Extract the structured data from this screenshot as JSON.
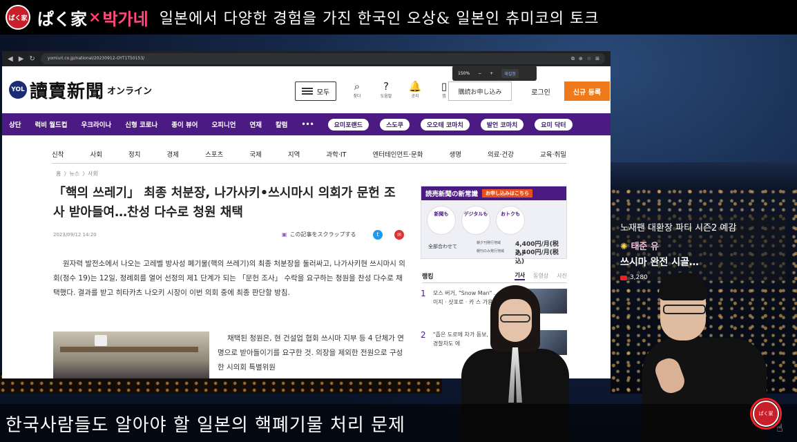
{
  "title_bar": {
    "logo_text": "ぱく家",
    "brand_jp": "ぱく家",
    "brand_x": "×",
    "brand_kr": "박가네",
    "description": "일본에서 다양한 경험을 가진 한국인 오상& 일본인 츄미코의 토크"
  },
  "browser": {
    "url": "yomiuri.co.jp/national/20230912-OYT1T50153/",
    "zoom_level": "150%",
    "zoom_minus": "−",
    "zoom_plus": "+",
    "zoom_reset": "재설정"
  },
  "site_header": {
    "badge": "YOL",
    "logo": "讀賣新聞",
    "logo_sub": "オンライン",
    "menu_label": "모두",
    "icons": [
      {
        "glyph": "⌕",
        "label": "찾다"
      },
      {
        "glyph": "?",
        "label": "도움말"
      },
      {
        "glyph": "🔔",
        "label": "공지"
      },
      {
        "glyph": "▯",
        "label": "앱"
      }
    ],
    "subscribe": "購読お申し込み",
    "login": "로그인",
    "signup": "신규 등록"
  },
  "purple_nav": {
    "items": [
      "상단",
      "럭비 월드컵",
      "우크라이나",
      "신형 코로나",
      "종이 뷰어",
      "오피니언",
      "연재",
      "칼럼",
      "•••"
    ],
    "pills": [
      "요미포랜드",
      "스도쿠",
      "오오테 코마치",
      "발언 코마치",
      "요미 닥터"
    ]
  },
  "category_nav": [
    "신착",
    "사회",
    "정치",
    "경제",
    "스포츠",
    "국제",
    "지역",
    "과학·IT",
    "엔터테인먼트·문화",
    "생명",
    "의료·건강",
    "교육·취밀"
  ],
  "breadcrumb": [
    "홈",
    "〉뉴스",
    "〉사회"
  ],
  "article": {
    "headline": "「핵의 쓰레기」 최종 처분장, 나가사키•쓰시마시 의회가 문헌 조사 받아들여…찬성 다수로 청원 채택",
    "date": "2023/09/12 14:20",
    "scrap": "この記事をスクラップする",
    "paragraph1": "원자력 발전소에서 나오는 고레벨 방사성 폐기물(핵의 쓰레기)의 최종 처분장을 둘러싸고, 나가사키현 쓰시마시 의회(정수 19)는 12일, 정례회를 열어 선정의 제1 단계가 되는 「문헌 조사」 수락을 요구하는 청원을 찬성 다수로 채택했다. 결과를 받고 히타카츠 나오키 시장이 이번 의회 중에 최종 판단할 방침.",
    "paragraph2": "채택된 청원은, 현 건설업 협회 쓰시마 지부 등 4 단체가 연명으로 받아들이기를 요구한 것. 의장을 제외한 전원으로 구성한 시의회 특별위원"
  },
  "ad": {
    "title": "読売新聞の新常識",
    "cta": "お申し込みはこちら",
    "circles": [
      "新聞も",
      "デジタルも",
      "おトクも"
    ],
    "all_label": "全部合わせて",
    "label1": "朝夕刊発行地域",
    "label2": "朝刊のみ発行地域",
    "price1": "4,400円/月(税込)",
    "price2": "3,400円/月(税込)"
  },
  "ranking": {
    "title": "랭킹",
    "tabs": [
      "기사",
      "동영상",
      "사진"
    ],
    "items": [
      {
        "num": "1",
        "text": "모스 버거, \"Snow Man\" … 메이지 · 샷포로 · 카 스 가용 배송"
      },
      {
        "num": "2",
        "text": "\"좁은 도로에 차가 동보, 달려온 경찰차도 에"
      }
    ]
  },
  "promo": {
    "title": "노재팬 대환장 파티 시즌2 예감",
    "author": "태준 유",
    "subtitle": "쓰시마 완전 시골…",
    "views": "3,280"
  },
  "subtitle": "한국사람들도 알아야 할 일본의 핵폐기물 처리 문제",
  "colors": {
    "brand_pink": "#ff4a7c",
    "nav_purple": "#4b1b83",
    "signup_orange": "#ee7a1b"
  }
}
